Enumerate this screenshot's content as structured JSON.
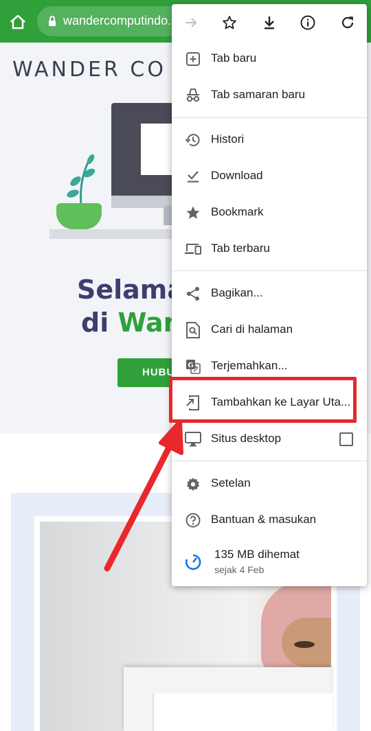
{
  "browser": {
    "url": "wandercomputindo.c",
    "theme_color": "#2fa03a"
  },
  "page": {
    "brand": "WANDER CO",
    "headline_line1": "Selama",
    "headline_line2_prefix": "di ",
    "headline_line2_green": "Wan",
    "cta_label": "HUBU"
  },
  "menu": {
    "toolbar": [
      {
        "name": "forward-button",
        "icon": "arrow-right-icon"
      },
      {
        "name": "bookmark-star-button",
        "icon": "star-outline-icon"
      },
      {
        "name": "download-page-button",
        "icon": "download-icon"
      },
      {
        "name": "page-info-button",
        "icon": "info-icon"
      },
      {
        "name": "reload-button",
        "icon": "reload-icon"
      }
    ],
    "items": [
      {
        "label": "Tab baru",
        "icon": "plus-box-icon"
      },
      {
        "label": "Tab samaran baru",
        "icon": "incognito-icon"
      },
      {
        "label": "Histori",
        "icon": "history-icon"
      },
      {
        "label": "Download",
        "icon": "download-check-icon"
      },
      {
        "label": "Bookmark",
        "icon": "star-icon"
      },
      {
        "label": "Tab terbaru",
        "icon": "devices-icon"
      },
      {
        "label": "Bagikan...",
        "icon": "share-icon"
      },
      {
        "label": "Cari di halaman",
        "icon": "find-in-page-icon"
      },
      {
        "label": "Terjemahkan...",
        "icon": "translate-icon"
      },
      {
        "label": "Tambahkan ke Layar Uta...",
        "icon": "add-to-home-icon"
      },
      {
        "label": "Situs desktop",
        "icon": "desktop-icon",
        "checked": false
      },
      {
        "label": "Setelan",
        "icon": "gear-icon"
      },
      {
        "label": "Bantuan & masukan",
        "icon": "help-icon"
      }
    ],
    "data_saver": {
      "main": "135 MB dihemat",
      "sub": "sejak 4 Feb",
      "icon": "data-saver-icon"
    }
  },
  "annotation": {
    "color": "#e8282b"
  }
}
